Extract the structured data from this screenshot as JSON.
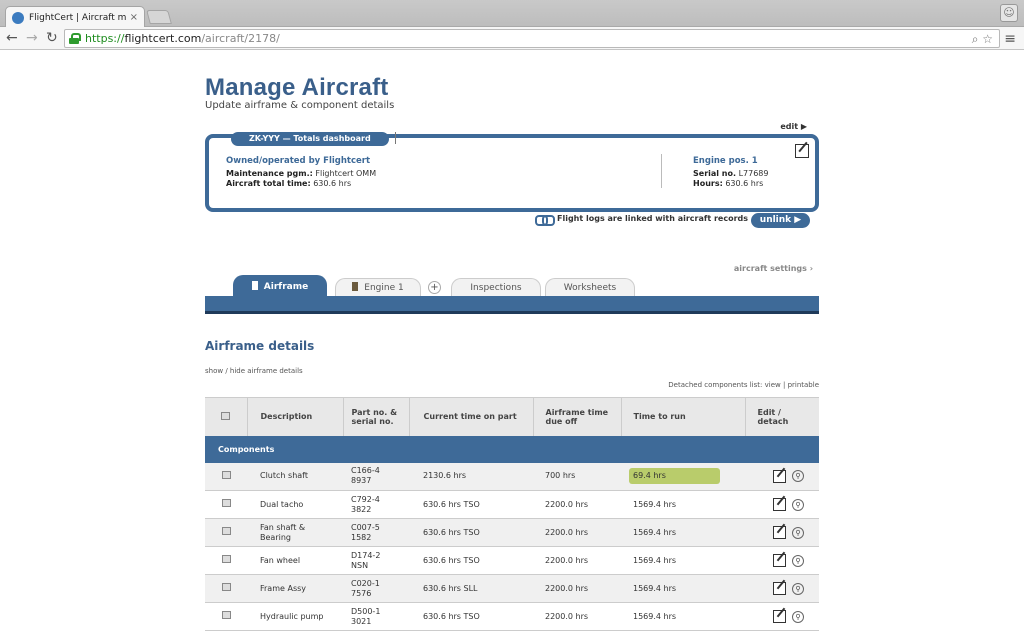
{
  "browser": {
    "tab_title": "FlightCert | Aircraft mainte",
    "tab_close": "×",
    "url_scheme": "https://",
    "url_host": "flightcert.com",
    "url_path": "/aircraft/2178/",
    "nav_back": "←",
    "nav_forward": "→",
    "nav_reload": "↻",
    "zoom": "⌕ ☆",
    "menu": "≡"
  },
  "header": {
    "title": "Manage Aircraft",
    "subtitle": "Update airframe & component details",
    "edit_link": "edit ▶"
  },
  "dashboard": {
    "tab_label": "ZK-YYY — Totals dashboard",
    "owner": "Owned/operated by Flightcert",
    "pgm_label": "Maintenance pgm.:",
    "pgm_value": "Flightcert OMM",
    "total_label": "Aircraft total time:",
    "total_value": "630.6 hrs",
    "engine_title": "Engine pos. 1",
    "serial_label": "Serial no.",
    "serial_value": "L77689",
    "hours_label": "Hours:",
    "hours_value": "630.6 hrs"
  },
  "links": {
    "linked_text": "Flight logs are linked with aircraft records",
    "unlink_label": "unlink ▶",
    "settings": "aircraft settings ›"
  },
  "tabs": [
    {
      "label": "Airframe"
    },
    {
      "label": "Engine 1"
    },
    {
      "label": "+"
    },
    {
      "label": "Inspections"
    },
    {
      "label": "Worksheets"
    }
  ],
  "section": {
    "title": "Airframe details",
    "showhide": "show / hide airframe details",
    "detached_label": "Detached components list:",
    "detached_view": "view",
    "detached_sep": "|",
    "detached_printable": "printable"
  },
  "table": {
    "headers": [
      "",
      "Description",
      "Part no. & serial no.",
      "Current time on part",
      "Airframe time due off",
      "Time to run",
      "Edit / detach"
    ],
    "category": "Components",
    "rows": [
      {
        "desc": "Clutch shaft",
        "part": "C166-4",
        "serial": "8937",
        "current": "2130.6 hrs",
        "due": "700 hrs",
        "ttr": "69.4 hrs",
        "warn": true
      },
      {
        "desc": "Dual tacho",
        "part": "C792-4",
        "serial": "3822",
        "current": "630.6 hrs TSO",
        "due": "2200.0 hrs",
        "ttr": "1569.4 hrs",
        "warn": false
      },
      {
        "desc": "Fan shaft & Bearing",
        "part": "C007-5",
        "serial": "1582",
        "current": "630.6 hrs TSO",
        "due": "2200.0 hrs",
        "ttr": "1569.4 hrs",
        "warn": false
      },
      {
        "desc": "Fan wheel",
        "part": "D174-2",
        "serial": "NSN",
        "current": "630.6 hrs TSO",
        "due": "2200.0 hrs",
        "ttr": "1569.4 hrs",
        "warn": false
      },
      {
        "desc": "Frame Assy",
        "part": "C020-1",
        "serial": "7576",
        "current": "630.6 hrs SLL",
        "due": "2200.0 hrs",
        "ttr": "1569.4 hrs",
        "warn": false
      },
      {
        "desc": "Hydraulic pump",
        "part": "D500-1",
        "serial": "3021",
        "current": "630.6 hrs TSO",
        "due": "2200.0 hrs",
        "ttr": "1569.4 hrs",
        "warn": false
      }
    ]
  },
  "colors": {
    "brand": "#3e6a98",
    "brand_dark": "#1f3a5a",
    "warn": "#b9cc6b"
  }
}
